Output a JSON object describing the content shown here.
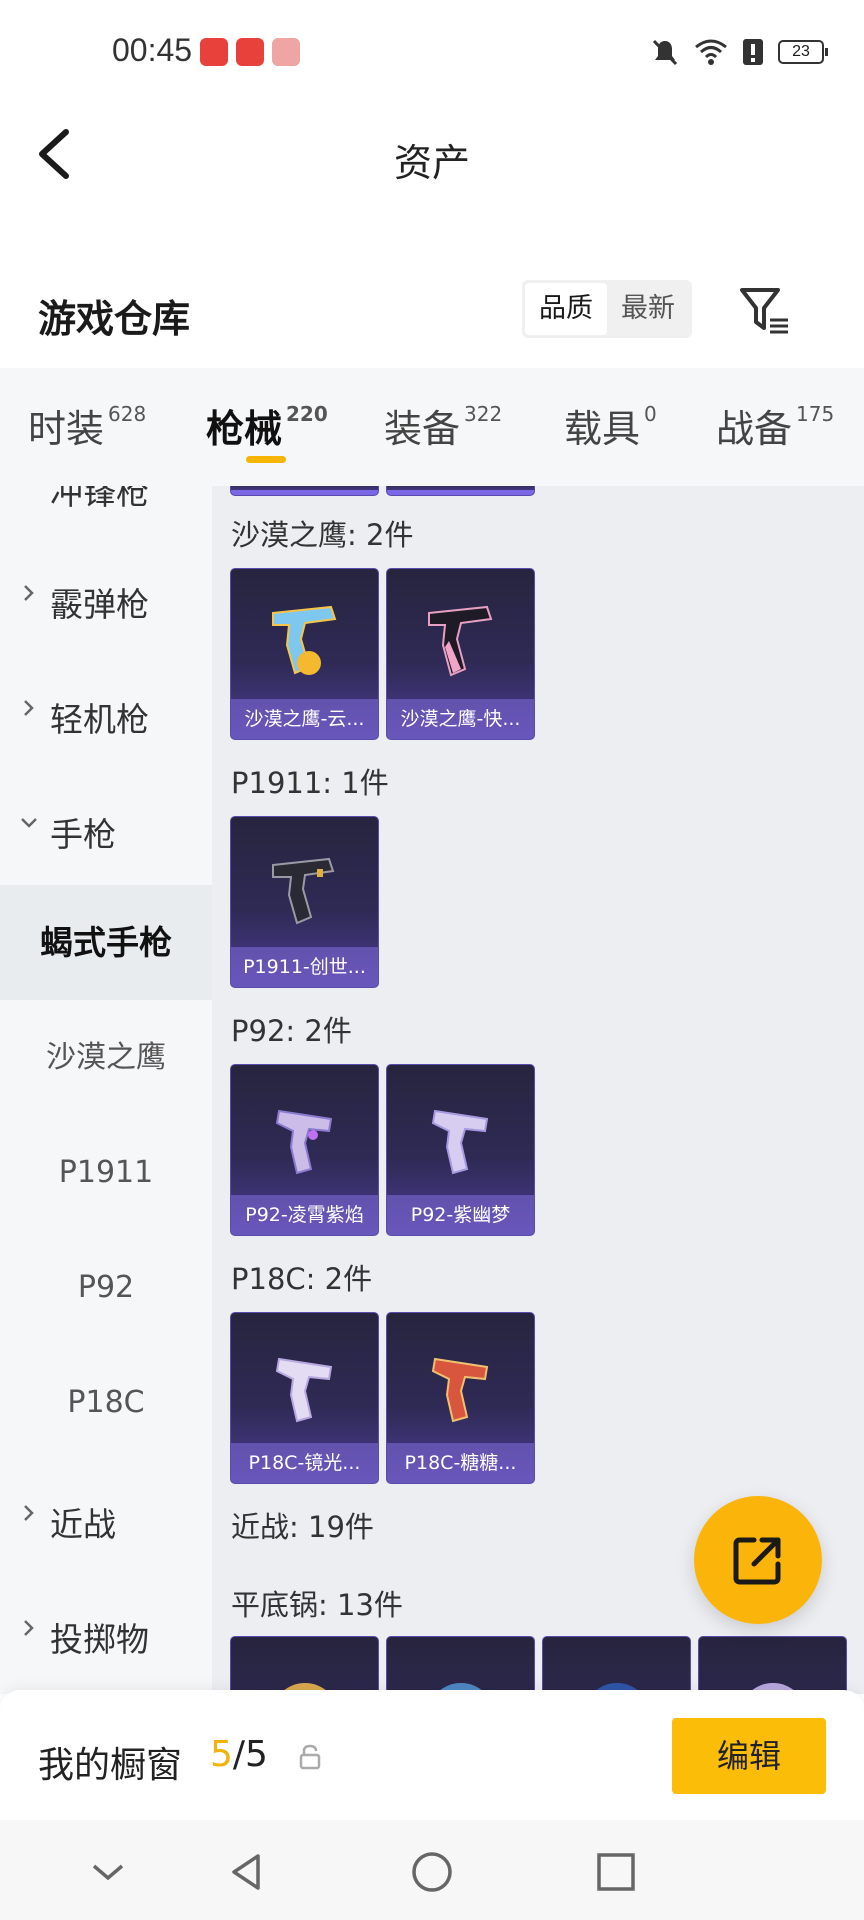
{
  "status_bar": {
    "time": "00:45",
    "battery": "23",
    "icons": [
      "mute-icon",
      "wifi-icon",
      "alert-icon",
      "battery-icon"
    ]
  },
  "header": {
    "title": "资产"
  },
  "warehouse": {
    "title": "游戏仓库",
    "sort_options": [
      "品质",
      "最新"
    ],
    "selected_sort": "品质"
  },
  "tabs": [
    {
      "label": "时装",
      "count": "628"
    },
    {
      "label": "枪械",
      "count": "220"
    },
    {
      "label": "装备",
      "count": "322"
    },
    {
      "label": "载具",
      "count": "0"
    },
    {
      "label": "战备",
      "count": "175"
    }
  ],
  "sidebar": {
    "partial_top": "冲锋枪",
    "categories": [
      "霰弹枪",
      "轻机枪",
      "手枪"
    ],
    "subcategories": [
      "蝎式手枪",
      "沙漠之鹰",
      "P1911",
      "P92",
      "P18C"
    ],
    "active_sub": "蝎式手枪",
    "lower_categories": [
      "近战",
      "投掷物"
    ]
  },
  "groups": [
    {
      "title": "沙漠之鹰: 2件",
      "items": [
        "沙漠之鹰-云...",
        "沙漠之鹰-快..."
      ]
    },
    {
      "title": "P1911: 1件",
      "items": [
        "P1911-创世..."
      ]
    },
    {
      "title": "P92: 2件",
      "items": [
        "P92-凌霄紫焰",
        "P92-紫幽梦"
      ]
    },
    {
      "title": "P18C: 2件",
      "items": [
        "P18C-镜光...",
        "P18C-糖糖..."
      ]
    },
    {
      "title": "近战: 19件",
      "items": []
    },
    {
      "title": "平底锅: 13件",
      "items": []
    }
  ],
  "window": {
    "label": "我的橱窗",
    "count_current": "5",
    "count_sep": "/",
    "count_total": "5",
    "edit_label": "编辑"
  },
  "colors": {
    "accent": "#fbbd08",
    "card_bg": "#2f2a55",
    "card_border": "#5a4bb0"
  }
}
